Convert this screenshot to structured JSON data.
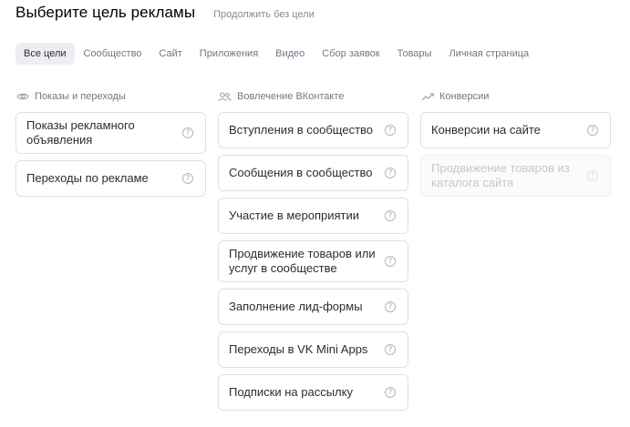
{
  "header": {
    "title": "Выберите цель рекламы",
    "skip_link": "Продолжить без цели"
  },
  "tabs": [
    {
      "label": "Все цели",
      "active": true
    },
    {
      "label": "Сообщество"
    },
    {
      "label": "Сайт"
    },
    {
      "label": "Приложения"
    },
    {
      "label": "Видео"
    },
    {
      "label": "Сбор заявок"
    },
    {
      "label": "Товары"
    },
    {
      "label": "Личная страница"
    }
  ],
  "help_glyph": "?",
  "columns": [
    {
      "title": "Показы и переходы",
      "icon": "eye-icon",
      "items": [
        {
          "label": "Показы рекламного объявления"
        },
        {
          "label": "Переходы по рекламе"
        }
      ]
    },
    {
      "title": "Вовлечение ВКонтакте",
      "icon": "users-icon",
      "items": [
        {
          "label": "Вступления в сообщество"
        },
        {
          "label": "Сообщения в сообщество"
        },
        {
          "label": "Участие в мероприятии"
        },
        {
          "label": "Продвижение товаров или услуг в сообществе"
        },
        {
          "label": "Заполнение лид-формы"
        },
        {
          "label": "Переходы в VK Mini Apps"
        },
        {
          "label": "Подписки на рассылку"
        }
      ]
    },
    {
      "title": "Конверсии",
      "icon": "trend-up-icon",
      "items": [
        {
          "label": "Конверсии на сайте"
        },
        {
          "label": "Продвижение товаров из каталога сайта",
          "disabled": true
        }
      ]
    }
  ],
  "colors": {
    "tab_active_bg": "#eceef2",
    "card_border": "#dce1e6",
    "muted_text": "#6d7885",
    "disabled_text": "#c4c8cc"
  }
}
